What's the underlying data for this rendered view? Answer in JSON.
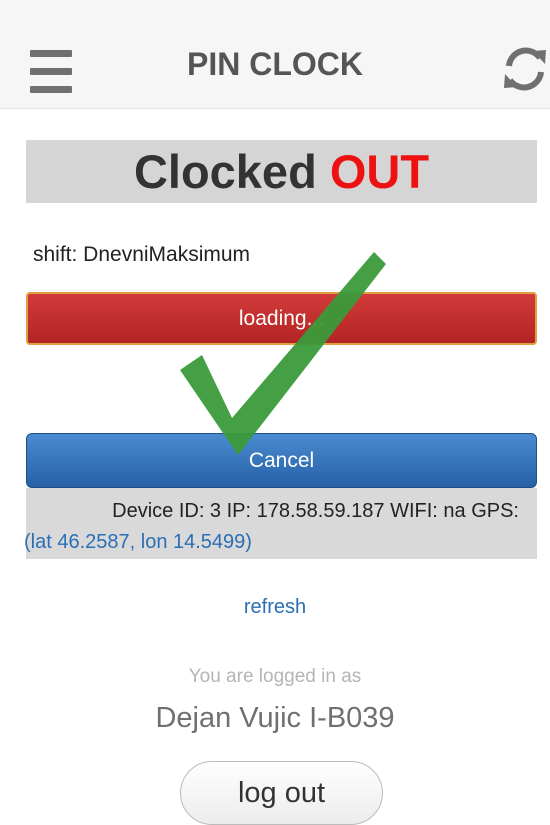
{
  "header": {
    "title": "PIN CLOCK"
  },
  "status": {
    "prefix": "Clocked",
    "state": "OUT"
  },
  "shift": {
    "text": "shift: DnevniMaksimum"
  },
  "loading_button": {
    "label": "loading..."
  },
  "cancel_button": {
    "label": "Cancel"
  },
  "device": {
    "info": "Device ID: 3  IP: 178.58.59.187  WIFI: na  GPS:",
    "gps": "(lat 46.2587, lon 14.5499)"
  },
  "refresh_link": "refresh",
  "user": {
    "logged_in_label": "You are logged in as",
    "name": "Dejan Vujic I-B039"
  },
  "logout_button": {
    "label": "log out"
  },
  "colors": {
    "out": "#ee1111",
    "danger": "#c62e2e",
    "primary": "#2f6db3",
    "check": "#3b9a3a"
  },
  "icons": {
    "menu": "hamburger-icon",
    "refresh": "refresh-icon",
    "overlay": "checkmark-icon"
  }
}
